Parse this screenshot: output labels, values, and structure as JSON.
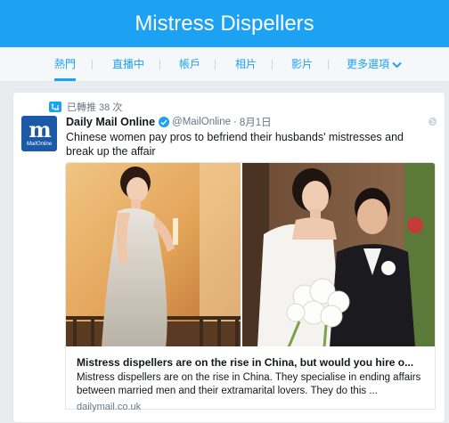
{
  "header": {
    "title": "Mistress Dispellers"
  },
  "tabs": {
    "items": [
      {
        "label": "熱門"
      },
      {
        "label": "直播中"
      },
      {
        "label": "帳戶"
      },
      {
        "label": "相片"
      },
      {
        "label": "影片"
      },
      {
        "label": "更多選項"
      }
    ],
    "active_index": 0
  },
  "tweet": {
    "retweet_text": "已轉推 38 次",
    "avatar_letter": "m",
    "avatar_sub": "MailOnline",
    "display_name": "Daily Mail Online",
    "handle": "@MailOnline",
    "separator": "·",
    "date": "8月1日",
    "text": "Chinese women pay pros to befriend their husbands' mistresses and break up the affair",
    "card": {
      "title": "Mistress dispellers are on the rise in China, but would you hire o...",
      "description": "Mistress dispellers are on the rise in China. They specialise in ending affairs between married men and their extramarital lovers. They do this ...",
      "domain": "dailymail.co.uk"
    }
  },
  "colors": {
    "brand": "#1da1f2",
    "text": "#14171a",
    "muted": "#657786"
  },
  "icons": [
    "retweet-icon",
    "verified-icon",
    "globe-icon",
    "chevron-down-icon"
  ]
}
